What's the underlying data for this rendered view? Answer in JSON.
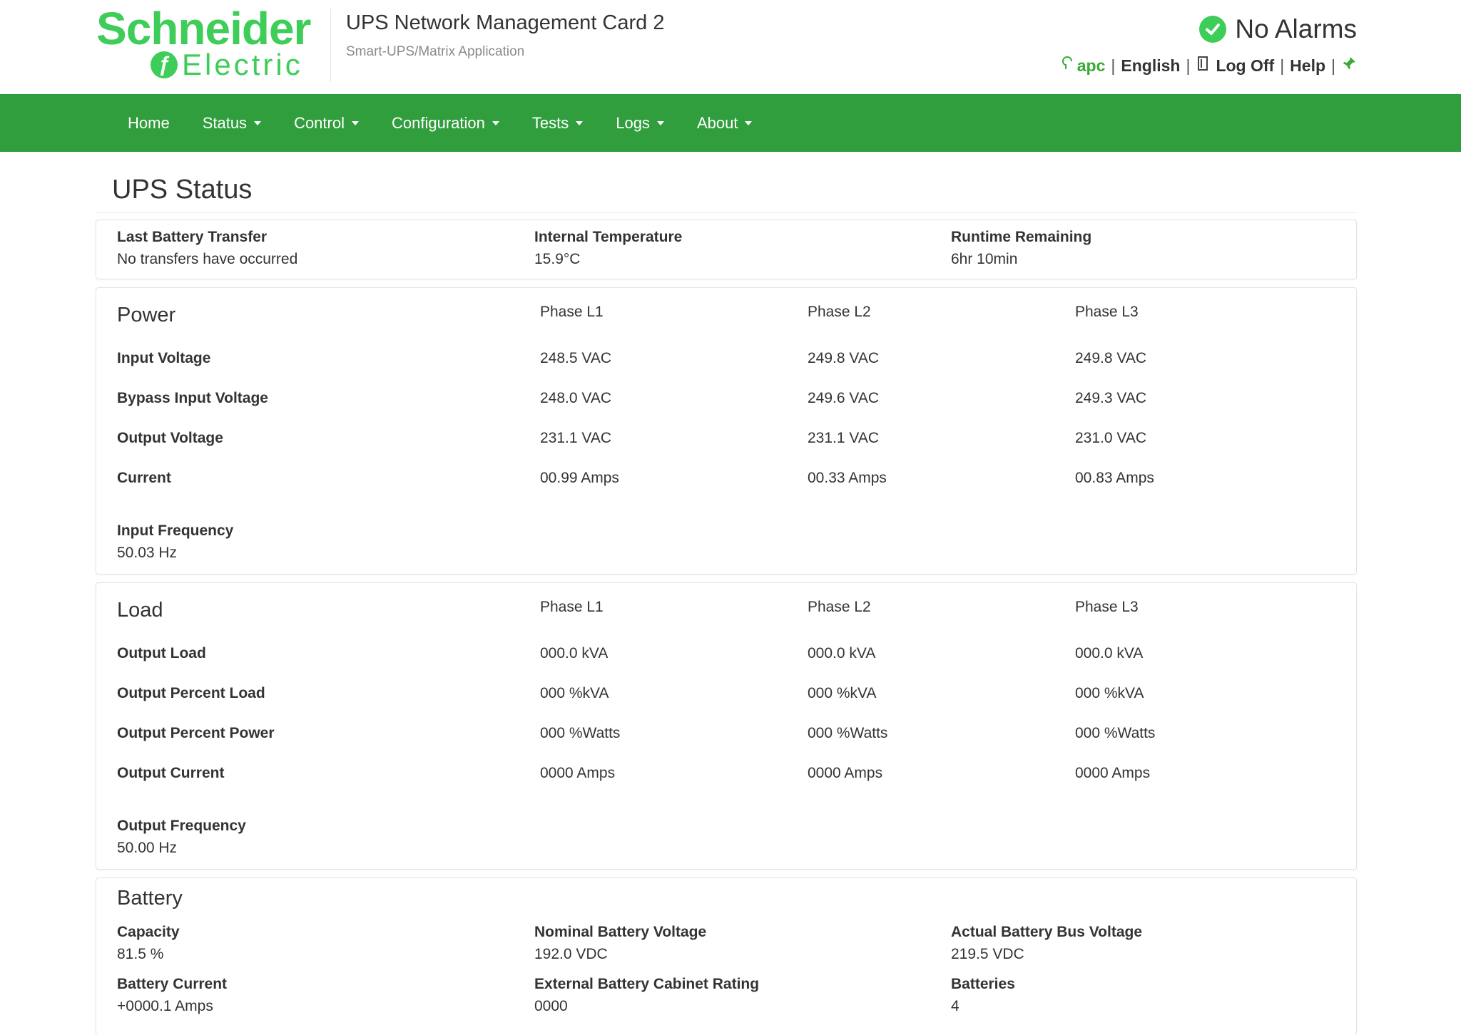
{
  "header": {
    "logo_word1": "Schneider",
    "logo_word2": "Electric",
    "app_title": "UPS Network Management Card 2",
    "app_subtitle": "Smart-UPS/Matrix Application",
    "alarm_status": "No Alarms",
    "user": "apc",
    "language": "English",
    "logoff": "Log Off",
    "help": "Help"
  },
  "nav": {
    "home": "Home",
    "status": "Status",
    "control": "Control",
    "configuration": "Configuration",
    "tests": "Tests",
    "logs": "Logs",
    "about": "About"
  },
  "page": {
    "title": "UPS Status"
  },
  "summary": {
    "last_transfer_label": "Last Battery Transfer",
    "last_transfer_value": "No transfers have occurred",
    "temp_label": "Internal Temperature",
    "temp_value": "15.9°C",
    "runtime_label": "Runtime Remaining",
    "runtime_value": "6hr 10min"
  },
  "power": {
    "title": "Power",
    "phases": [
      "Phase L1",
      "Phase L2",
      "Phase L3"
    ],
    "rows": [
      {
        "label": "Input Voltage",
        "values": [
          "248.5 VAC",
          "249.8 VAC",
          "249.8 VAC"
        ]
      },
      {
        "label": "Bypass Input Voltage",
        "values": [
          "248.0 VAC",
          "249.6 VAC",
          "249.3 VAC"
        ]
      },
      {
        "label": "Output Voltage",
        "values": [
          "231.1 VAC",
          "231.1 VAC",
          "231.0 VAC"
        ]
      },
      {
        "label": "Current",
        "values": [
          "00.99 Amps",
          "00.33 Amps",
          "00.83 Amps"
        ]
      }
    ],
    "freq_label": "Input Frequency",
    "freq_value": "50.03  Hz"
  },
  "load": {
    "title": "Load",
    "phases": [
      "Phase L1",
      "Phase L2",
      "Phase L3"
    ],
    "rows": [
      {
        "label": "Output Load",
        "values": [
          "000.0 kVA",
          "000.0 kVA",
          "000.0 kVA"
        ]
      },
      {
        "label": "Output Percent Load",
        "values": [
          "000 %kVA",
          "000 %kVA",
          "000 %kVA"
        ]
      },
      {
        "label": "Output Percent Power",
        "values": [
          "000 %Watts",
          "000 %Watts",
          "000 %Watts"
        ]
      },
      {
        "label": "Output Current",
        "values": [
          "0000 Amps",
          "0000 Amps",
          "0000 Amps"
        ]
      }
    ],
    "freq_label": "Output Frequency",
    "freq_value": "50.00  Hz"
  },
  "battery": {
    "title": "Battery",
    "capacity_label": "Capacity",
    "capacity_value": "81.5 %",
    "nominal_label": "Nominal Battery Voltage",
    "nominal_value": "192.0  VDC",
    "actual_label": "Actual Battery Bus Voltage",
    "actual_value": "219.5  VDC",
    "current_label": "Battery Current",
    "current_value": "+0000.1  Amps",
    "cabinet_label": "External Battery Cabinet Rating",
    "cabinet_value": "0000",
    "batteries_label": "Batteries",
    "batteries_value": "4"
  },
  "colors": {
    "brand_green": "#3dcd58",
    "nav_green": "#319e3e"
  }
}
